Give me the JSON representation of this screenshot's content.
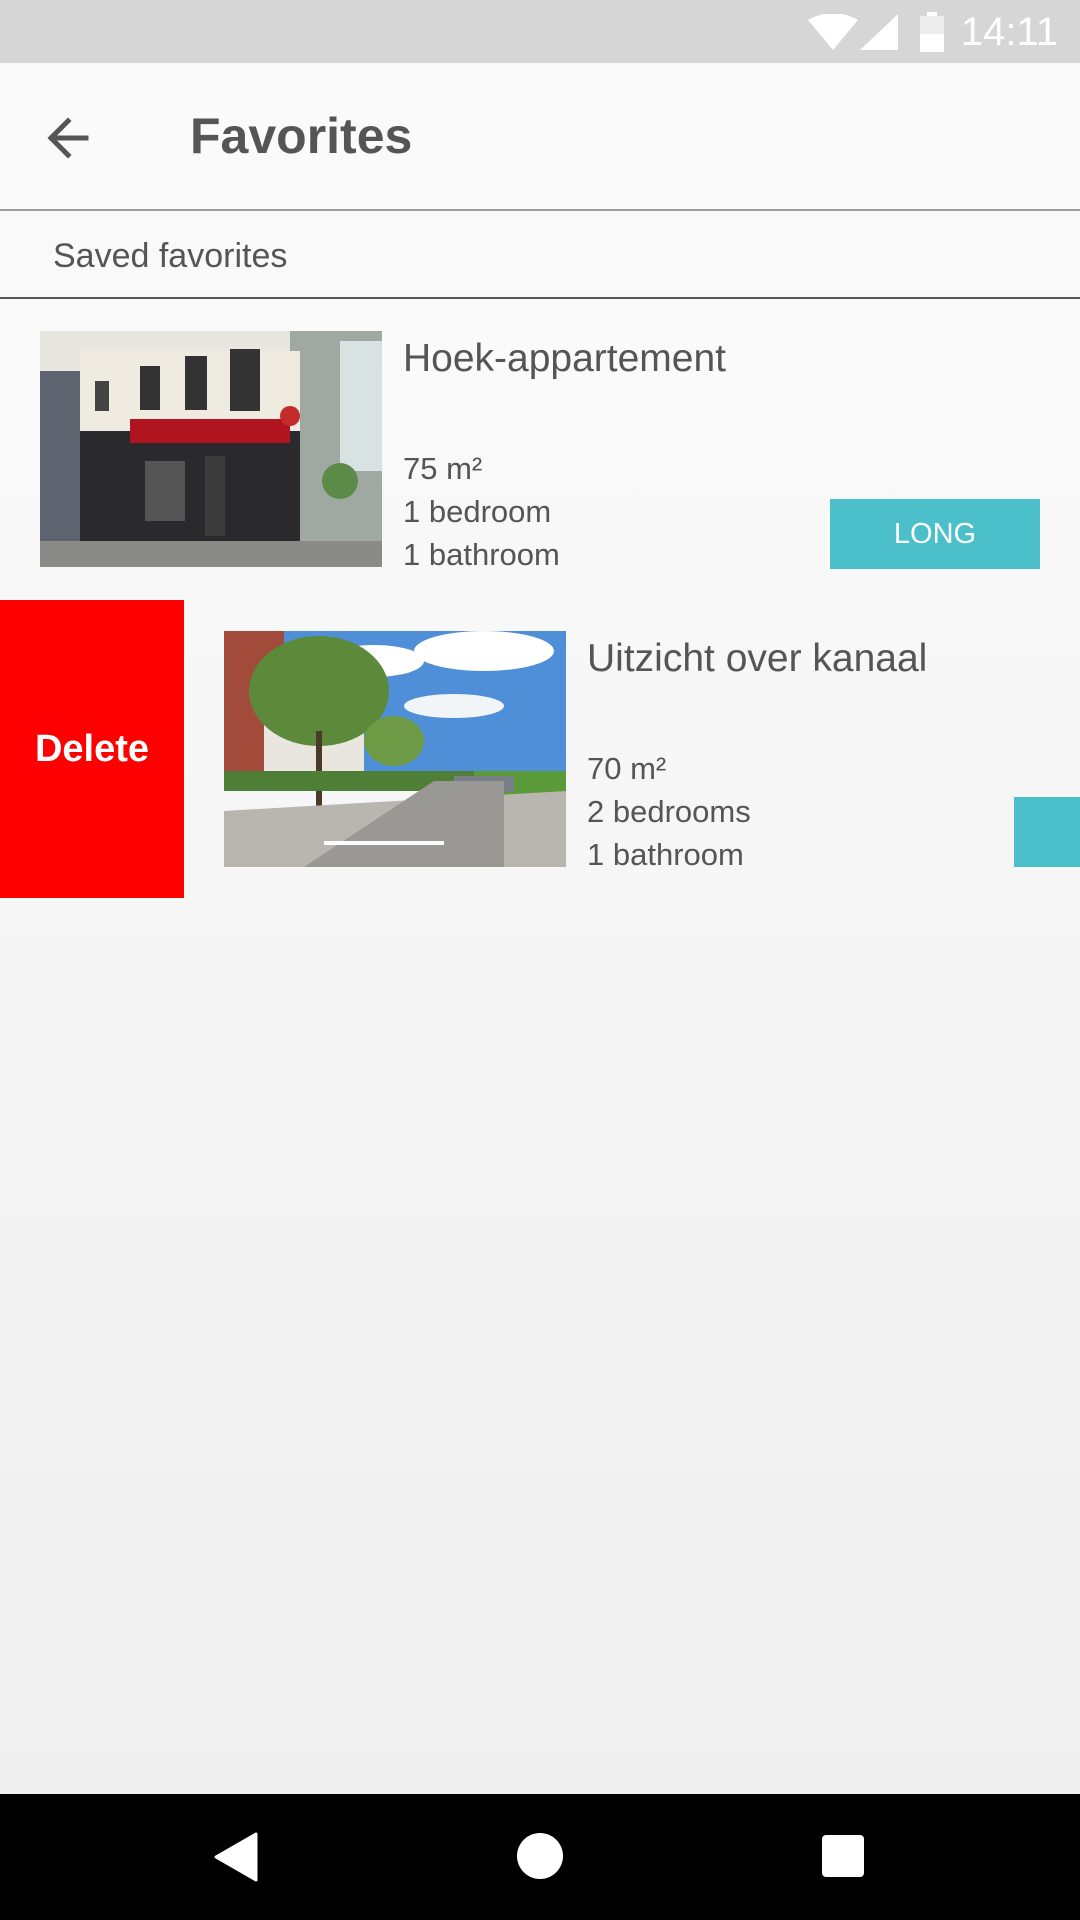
{
  "status_bar": {
    "time": "14:11"
  },
  "app_bar": {
    "title": "Favorites"
  },
  "section": {
    "label": "Saved favorites"
  },
  "listings": [
    {
      "title": "Hoek-appartement",
      "area": "75 m²",
      "bedrooms": "1 bedroom",
      "bathrooms": "1 bathroom",
      "tag": "LONG",
      "image": "corner-building-cafe-rex"
    },
    {
      "title": "Uitzicht over kanaal",
      "area": "70 m²",
      "bedrooms": "2 bedrooms",
      "bathrooms": "1 bathroom",
      "tag": "",
      "image": "tree-lined-street-with-parked-cars"
    }
  ],
  "swipe_action": {
    "label": "Delete",
    "color": "#ff0000"
  },
  "colors": {
    "accent": "#4bbfca",
    "text": "#555555"
  }
}
